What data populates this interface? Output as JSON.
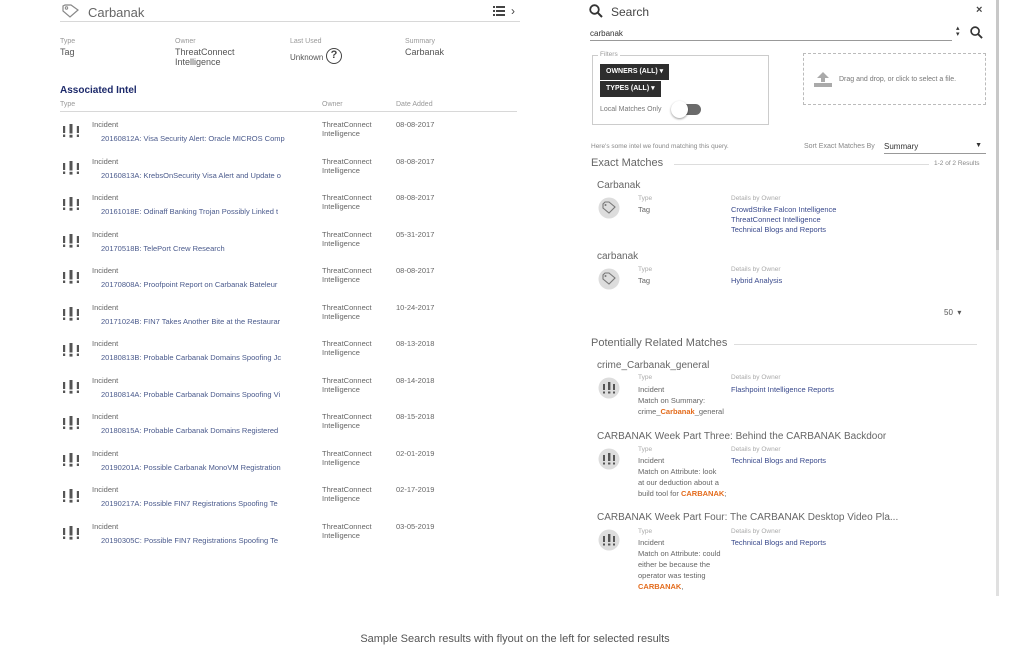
{
  "left_panel": {
    "title": "Carbanak",
    "meta": {
      "type_label": "Type",
      "type_value": "Tag",
      "owner_label": "Owner",
      "owner_value": "ThreatConnect Intelligence",
      "last_used_label": "Last Used",
      "last_used_value": "Unknown",
      "summary_label": "Summary",
      "summary_value": "Carbanak"
    },
    "section_title": "Associated Intel",
    "columns": {
      "type": "Type",
      "owner": "Owner",
      "date": "Date Added"
    },
    "rows": [
      {
        "type": "Incident",
        "name": "20160812A: Visa Security Alert: Oracle MICROS Comp",
        "owner": "ThreatConnect Intelligence",
        "date": "08-08-2017"
      },
      {
        "type": "Incident",
        "name": "20160813A: KrebsOnSecurity Visa Alert and Update o",
        "owner": "ThreatConnect Intelligence",
        "date": "08-08-2017"
      },
      {
        "type": "Incident",
        "name": "20161018E: Odinaff Banking Trojan Possibly Linked t",
        "owner": "ThreatConnect Intelligence",
        "date": "08-08-2017"
      },
      {
        "type": "Incident",
        "name": "20170518B: TelePort Crew Research",
        "owner": "ThreatConnect Intelligence",
        "date": "05-31-2017"
      },
      {
        "type": "Incident",
        "name": "20170808A: Proofpoint Report on Carbanak Bateleur",
        "owner": "ThreatConnect Intelligence",
        "date": "08-08-2017"
      },
      {
        "type": "Incident",
        "name": "20171024B: FIN7 Takes Another Bite at the Restaurar",
        "owner": "ThreatConnect Intelligence",
        "date": "10-24-2017"
      },
      {
        "type": "Incident",
        "name": "20180813B: Probable Carbanak Domains Spoofing Jc",
        "owner": "ThreatConnect Intelligence",
        "date": "08-13-2018"
      },
      {
        "type": "Incident",
        "name": "20180814A: Probable Carbanak Domains Spoofing Vi",
        "owner": "ThreatConnect Intelligence",
        "date": "08-14-2018"
      },
      {
        "type": "Incident",
        "name": "20180815A: Probable Carbanak Domains Registered",
        "owner": "ThreatConnect Intelligence",
        "date": "08-15-2018"
      },
      {
        "type": "Incident",
        "name": "20190201A: Possible Carbanak MonoVM Registration",
        "owner": "ThreatConnect Intelligence",
        "date": "02-01-2019"
      },
      {
        "type": "Incident",
        "name": "20190217A: Possible FIN7 Registrations Spoofing Te",
        "owner": "ThreatConnect Intelligence",
        "date": "02-17-2019"
      },
      {
        "type": "Incident",
        "name": "20190305C: Possible FIN7 Registrations Spoofing Te",
        "owner": "ThreatConnect Intelligence",
        "date": "03-05-2019"
      }
    ]
  },
  "search_panel": {
    "title": "Search",
    "query": "carbanak",
    "filters_label": "Filters",
    "owners_button": "OWNERS (ALL)",
    "types_button": "TYPES (ALL)",
    "local_matches_label": "Local Matches Only",
    "dropzone_text": "Drag and drop, or click to select a file.",
    "intro_text": "Here's some intel we found matching this query.",
    "sort_label": "Sort Exact Matches By",
    "sort_value": "Summary",
    "exact_title": "Exact Matches",
    "exact_count": "1-2 of 2 Results",
    "label_type": "Type",
    "label_details": "Details by Owner",
    "exact_matches": [
      {
        "name": "Carbanak",
        "type": "Tag",
        "owners": [
          "CrowdStrike Falcon Intelligence",
          "ThreatConnect Intelligence",
          "Technical Blogs and Reports"
        ]
      },
      {
        "name": "carbanak",
        "type": "Tag",
        "owners": [
          "Hybrid Analysis"
        ]
      }
    ],
    "per_page": "50",
    "related_title": "Potentially Related Matches",
    "related": [
      {
        "name": "crime_Carbanak_general",
        "type": "Incident",
        "match_pre": "Match on Summary:",
        "match_line": "crime_",
        "hl": "Carbanak",
        "match_post": "_general",
        "owner": "Flashpoint Intelligence Reports"
      },
      {
        "name": "CARBANAK Week Part Three: Behind the CARBANAK Backdoor",
        "type": "Incident",
        "match_pre": "Match on Attribute: look",
        "match_l2": "at our deduction about a",
        "match_l3": "build tool for",
        "hl": "CARBANAK",
        "match_post": ";",
        "owner": "Technical Blogs and Reports"
      },
      {
        "name": "CARBANAK Week Part Four: The CARBANAK Desktop Video Pla...",
        "type": "Incident",
        "match_pre": "Match on Attribute: could",
        "match_l2": "either be because the",
        "match_l3": "operator was testing",
        "hl": "CARBANAK",
        "match_post": ",",
        "owner": "Technical Blogs and Reports"
      }
    ]
  },
  "caption": "Sample Search results with flyout on the left for selected results",
  "colors": {
    "link": "#3a4a8c",
    "heading": "#1d2a6b",
    "highlight": "#e36b1c",
    "button": "#2e2e2e"
  }
}
